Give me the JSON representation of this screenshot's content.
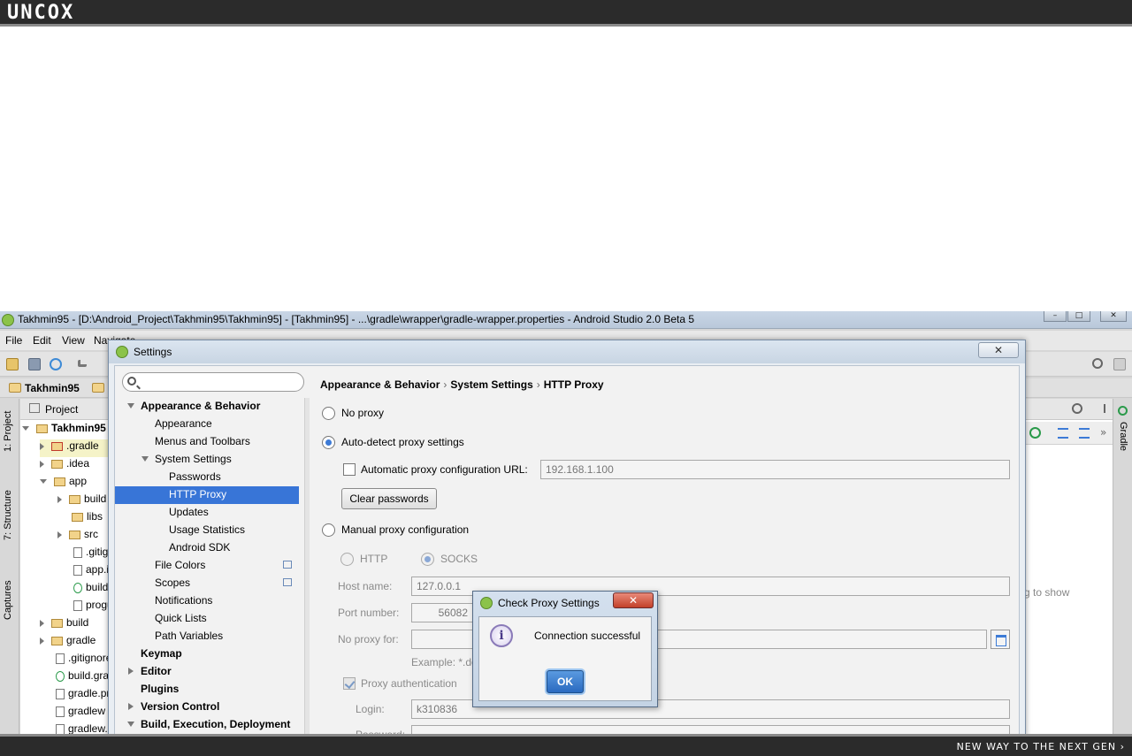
{
  "brand": {
    "logo_text": "UNCOX",
    "tagline": "NEW WAY TO THE NEXT GEN ›"
  },
  "ide": {
    "title": "Takhmin95 - [D:\\Android_Project\\Takhmin95\\Takhmin95] - [Takhmin95] - ...\\gradle\\wrapper\\gradle-wrapper.properties - Android Studio 2.0 Beta 5",
    "menu": [
      "File",
      "Edit",
      "View",
      "Navigate"
    ],
    "nav_crumb": "Takhmin95",
    "left_tabs": [
      "1: Project",
      "7: Structure",
      "Captures"
    ],
    "right_tab": "Gradle",
    "project_header": "Project",
    "project_tree": [
      {
        "label": "Takhmin95",
        "kind": "folder",
        "open": true
      },
      {
        "label": ".gradle",
        "kind": "folder"
      },
      {
        "label": ".idea",
        "kind": "folder"
      },
      {
        "label": "app",
        "kind": "folder",
        "open": true
      },
      {
        "label": "build",
        "kind": "folder"
      },
      {
        "label": "libs",
        "kind": "folder"
      },
      {
        "label": "src",
        "kind": "folder"
      },
      {
        "label": ".gitignore",
        "kind": "file"
      },
      {
        "label": "app.iml",
        "kind": "file"
      },
      {
        "label": "build.gradle",
        "kind": "gradle"
      },
      {
        "label": "proguard-rules.pro",
        "kind": "file"
      },
      {
        "label": "build",
        "kind": "folder"
      },
      {
        "label": "gradle",
        "kind": "folder"
      },
      {
        "label": ".gitignore",
        "kind": "file"
      },
      {
        "label": "build.gradle",
        "kind": "gradle"
      },
      {
        "label": "gradle.properties",
        "kind": "file"
      },
      {
        "label": "gradlew",
        "kind": "file"
      },
      {
        "label": "gradlew.bat",
        "kind": "file"
      }
    ],
    "right_hint": "g to show"
  },
  "settings": {
    "title": "Settings",
    "close_label": "X",
    "search_placeholder": "",
    "tree": [
      {
        "label": "Appearance & Behavior",
        "level": 0,
        "bold": true,
        "toggle": "open"
      },
      {
        "label": "Appearance",
        "level": 1
      },
      {
        "label": "Menus and Toolbars",
        "level": 1
      },
      {
        "label": "System Settings",
        "level": 1,
        "toggle": "open"
      },
      {
        "label": "Passwords",
        "level": 2
      },
      {
        "label": "HTTP Proxy",
        "level": 2,
        "selected": true
      },
      {
        "label": "Updates",
        "level": 2
      },
      {
        "label": "Usage Statistics",
        "level": 2
      },
      {
        "label": "Android SDK",
        "level": 2
      },
      {
        "label": "File Colors",
        "level": 1,
        "copy": true
      },
      {
        "label": "Scopes",
        "level": 1,
        "copy": true
      },
      {
        "label": "Notifications",
        "level": 1
      },
      {
        "label": "Quick Lists",
        "level": 1
      },
      {
        "label": "Path Variables",
        "level": 1
      },
      {
        "label": "Keymap",
        "level": 0,
        "bold": true
      },
      {
        "label": "Editor",
        "level": 0,
        "bold": true,
        "toggle": "closed"
      },
      {
        "label": "Plugins",
        "level": 0,
        "bold": true
      },
      {
        "label": "Version Control",
        "level": 0,
        "bold": true,
        "toggle": "closed"
      },
      {
        "label": "Build, Execution, Deployment",
        "level": 0,
        "bold": true,
        "toggle": "open"
      }
    ],
    "breadcrumb": [
      "Appearance & Behavior",
      "System Settings",
      "HTTP Proxy"
    ],
    "no_proxy_label": "No proxy",
    "auto_detect_label": "Auto-detect proxy settings",
    "auto_config_url_label": "Automatic proxy configuration URL:",
    "auto_config_url_value": "192.168.1.100",
    "clear_passwords_label": "Clear passwords",
    "manual_label": "Manual proxy configuration",
    "http_label": "HTTP",
    "socks_label": "SOCKS",
    "host_label": "Host name:",
    "host_value": "127.0.0.1",
    "port_label": "Port number:",
    "port_value": "56082",
    "no_proxy_for_label": "No proxy for:",
    "no_proxy_for_value": "",
    "example_label": "Example: *.do",
    "proxy_auth_label": "Proxy authentication",
    "login_label": "Login:",
    "login_value": "k310836",
    "password_label": "Password:"
  },
  "proxy_dialog": {
    "title": "Check Proxy Settings",
    "close_label": "X",
    "message": "Connection successful",
    "ok_label": "OK"
  }
}
